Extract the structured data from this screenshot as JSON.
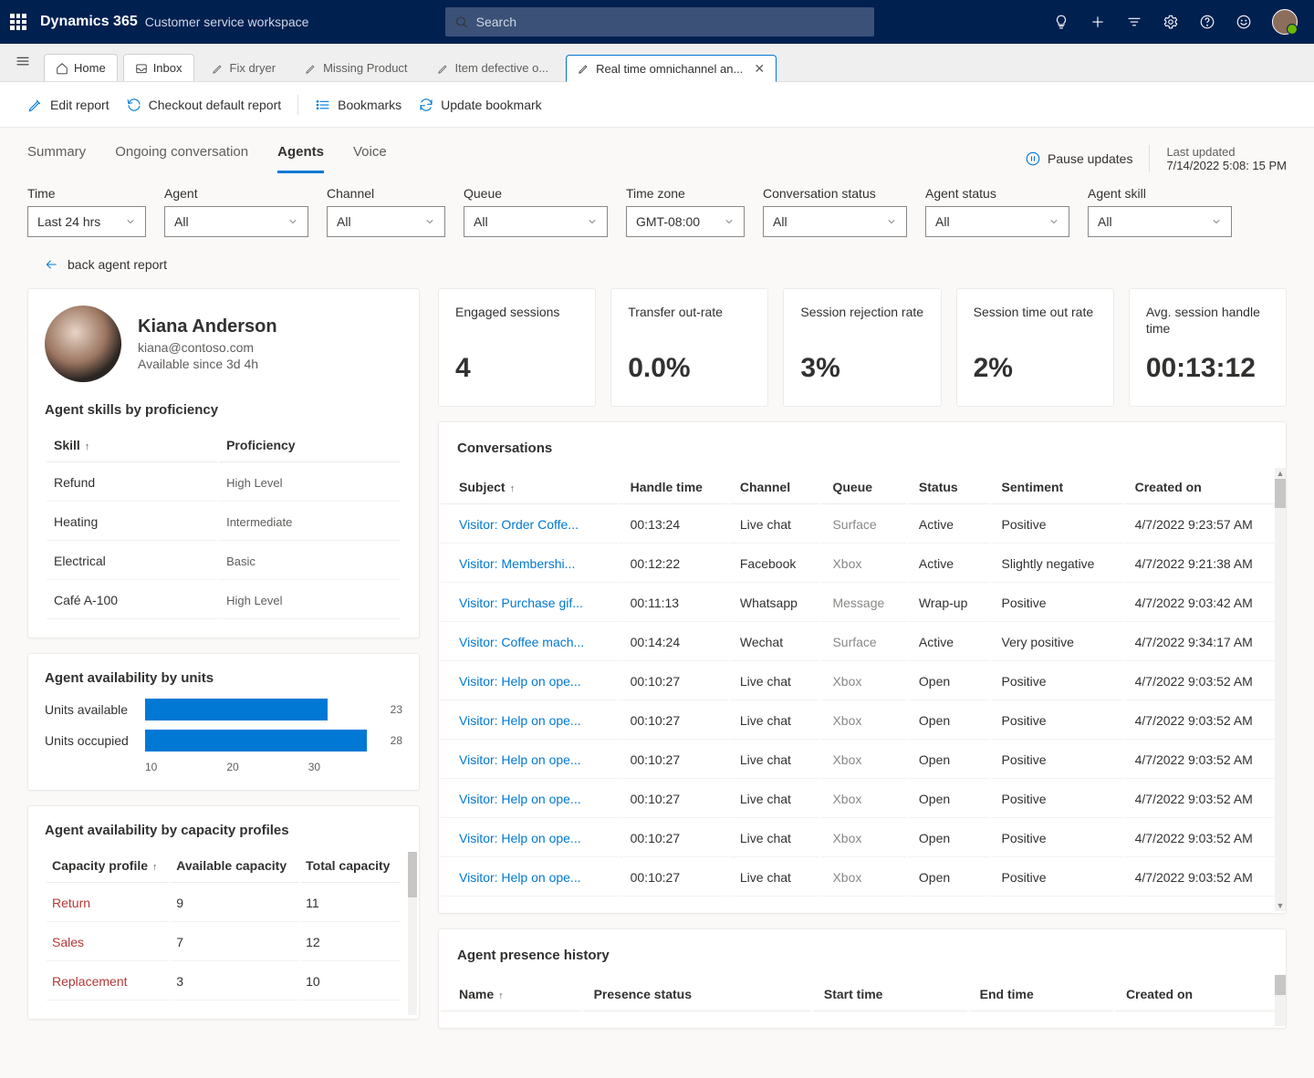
{
  "header": {
    "brand": "Dynamics 365",
    "subbrand": "Customer service workspace",
    "search_placeholder": "Search"
  },
  "tabs": [
    {
      "label": "Home",
      "icon": "home"
    },
    {
      "label": "Inbox",
      "icon": "inbox"
    },
    {
      "label": "Fix dryer",
      "icon": "pen",
      "plain": true
    },
    {
      "label": "Missing Product",
      "icon": "pen",
      "plain": true
    },
    {
      "label": "Item defective o...",
      "icon": "pen",
      "plain": true
    },
    {
      "label": "Real time omnichannel an...",
      "icon": "pen",
      "active": true,
      "closable": true
    }
  ],
  "commands": {
    "edit": "Edit report",
    "checkout": "Checkout default report",
    "bookmarks": "Bookmarks",
    "update": "Update bookmark"
  },
  "subtabs": [
    "Summary",
    "Ongoing conversation",
    "Agents",
    "Voice"
  ],
  "active_subtab": "Agents",
  "pause": "Pause updates",
  "last_updated_label": "Last updated",
  "last_updated_value": "7/14/2022 5:08: 15 PM",
  "filters": [
    {
      "label": "Time",
      "value": "Last 24 hrs"
    },
    {
      "label": "Agent",
      "value": "All",
      "wide": true
    },
    {
      "label": "Channel",
      "value": "All"
    },
    {
      "label": "Queue",
      "value": "All",
      "wide": true
    },
    {
      "label": "Time zone",
      "value": "GMT-08:00"
    },
    {
      "label": "Conversation status",
      "value": "All",
      "wide": true
    },
    {
      "label": "Agent status",
      "value": "All",
      "wide": true
    },
    {
      "label": "Agent skill",
      "value": "All",
      "wide": true
    }
  ],
  "back_link": "back agent report",
  "agent": {
    "name": "Kiana Anderson",
    "email": "kiana@contoso.com",
    "available": "Available since 3d 4h"
  },
  "skills": {
    "title": "Agent skills by proficiency",
    "col_skill": "Skill",
    "col_prof": "Proficiency",
    "rows": [
      {
        "skill": "Refund",
        "prof": "High Level"
      },
      {
        "skill": "Heating",
        "prof": "Intermediate"
      },
      {
        "skill": "Electrical",
        "prof": "Basic"
      },
      {
        "skill": "Café A-100",
        "prof": "High Level"
      }
    ]
  },
  "units": {
    "title": "Agent availability by units",
    "rows": [
      {
        "label": "Units available",
        "value": 23
      },
      {
        "label": "Units occupied",
        "value": 28
      }
    ],
    "axis": [
      "10",
      "20",
      "30"
    ]
  },
  "chart_data": {
    "type": "bar",
    "orientation": "horizontal",
    "title": "Agent availability by units",
    "xlabel": "",
    "ylabel": "",
    "categories": [
      "Units available",
      "Units occupied"
    ],
    "values": [
      23,
      28
    ],
    "xlim": [
      0,
      30
    ],
    "xticks": [
      10,
      20,
      30
    ]
  },
  "capacity": {
    "title": "Agent availability by capacity profiles",
    "col_profile": "Capacity profile",
    "col_avail": "Available capacity",
    "col_total": "Total capacity",
    "rows": [
      {
        "profile": "Return",
        "avail": "9",
        "total": "11"
      },
      {
        "profile": "Sales",
        "avail": "7",
        "total": "12"
      },
      {
        "profile": "Replacement",
        "avail": "3",
        "total": "10"
      }
    ]
  },
  "kpis": [
    {
      "title": "Engaged sessions",
      "value": "4"
    },
    {
      "title": "Transfer out-rate",
      "value": "0.0%"
    },
    {
      "title": "Session rejection rate",
      "value": "3%"
    },
    {
      "title": "Session time out rate",
      "value": "2%"
    },
    {
      "title": "Avg. session handle time",
      "value": "00:13:12"
    }
  ],
  "conversations": {
    "title": "Conversations",
    "cols": [
      "Subject",
      "Handle time",
      "Channel",
      "Queue",
      "Status",
      "Sentiment",
      "Created on"
    ],
    "rows": [
      {
        "subject": "Visitor: Order Coffe...",
        "handle": "00:13:24",
        "channel": "Live chat",
        "queue": "Surface",
        "status": "Active",
        "sentiment": "Positive",
        "created": "4/7/2022 9:23:57 AM"
      },
      {
        "subject": "Visitor: Membershi...",
        "handle": "00:12:22",
        "channel": "Facebook",
        "queue": "Xbox",
        "status": "Active",
        "sentiment": "Slightly negative",
        "created": "4/7/2022 9:21:38 AM"
      },
      {
        "subject": "Visitor: Purchase gif...",
        "handle": "00:11:13",
        "channel": "Whatsapp",
        "queue": "Message",
        "status": "Wrap-up",
        "sentiment": "Positive",
        "created": "4/7/2022 9:03:42 AM"
      },
      {
        "subject": "Visitor: Coffee mach...",
        "handle": "00:14:24",
        "channel": "Wechat",
        "queue": "Surface",
        "status": "Active",
        "sentiment": "Very positive",
        "created": "4/7/2022 9:34:17 AM"
      },
      {
        "subject": "Visitor: Help on ope...",
        "handle": "00:10:27",
        "channel": "Live chat",
        "queue": "Xbox",
        "status": "Open",
        "sentiment": "Positive",
        "created": "4/7/2022 9:03:52 AM"
      },
      {
        "subject": "Visitor: Help on ope...",
        "handle": "00:10:27",
        "channel": "Live chat",
        "queue": "Xbox",
        "status": "Open",
        "sentiment": "Positive",
        "created": "4/7/2022 9:03:52 AM"
      },
      {
        "subject": "Visitor: Help on ope...",
        "handle": "00:10:27",
        "channel": "Live chat",
        "queue": "Xbox",
        "status": "Open",
        "sentiment": "Positive",
        "created": "4/7/2022 9:03:52 AM"
      },
      {
        "subject": "Visitor: Help on ope...",
        "handle": "00:10:27",
        "channel": "Live chat",
        "queue": "Xbox",
        "status": "Open",
        "sentiment": "Positive",
        "created": "4/7/2022 9:03:52 AM"
      },
      {
        "subject": "Visitor: Help on ope...",
        "handle": "00:10:27",
        "channel": "Live chat",
        "queue": "Xbox",
        "status": "Open",
        "sentiment": "Positive",
        "created": "4/7/2022 9:03:52 AM"
      },
      {
        "subject": "Visitor: Help on ope...",
        "handle": "00:10:27",
        "channel": "Live chat",
        "queue": "Xbox",
        "status": "Open",
        "sentiment": "Positive",
        "created": "4/7/2022 9:03:52 AM"
      }
    ]
  },
  "presence": {
    "title": "Agent presence history",
    "cols": [
      "Name",
      "Presence status",
      "Start time",
      "End time",
      "Created on"
    ]
  }
}
